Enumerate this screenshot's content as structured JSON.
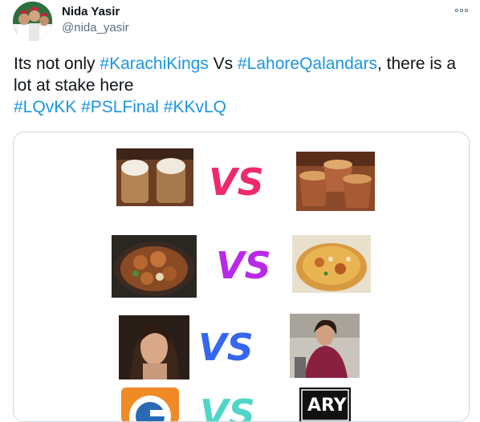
{
  "author": {
    "name": "Nida Yasir",
    "handle": "@nida_yasir",
    "avatar_icon": "profile-photo"
  },
  "menu_icon": "more-options-icon",
  "tweet": {
    "line1_pre": "Its not only ",
    "tag_karachi": "#KarachiKings",
    "line1_mid": " Vs ",
    "tag_lahore": "#LahoreQalandars",
    "line1_post": ", there is a lot at stake here",
    "tag_lqvkk": "#LQvKK",
    "tag_pslfinal": "#PSLFinal",
    "tag_kkvlq": "#KKvLQ"
  },
  "media": {
    "vs_text": "VS",
    "vs_colors": [
      "#ee2a6a",
      "#b82be6",
      "#3566ee",
      "#4fd6c8"
    ],
    "logo_text": "ARY",
    "rows": [
      {
        "left": "doodh-patti-cups-photo",
        "right": "chai-cups-photo"
      },
      {
        "left": "karahi-photo",
        "right": "biryani-photo"
      },
      {
        "left": "actress-portrait-photo",
        "right": "woman-portrait-photo"
      },
      {
        "left": "geo-logo",
        "right": "ary-logo"
      }
    ]
  },
  "colors": {
    "hashtag": "#1b95e0",
    "text": "#0f1419",
    "secondary": "#5b7083",
    "border": "#cfd9de"
  }
}
